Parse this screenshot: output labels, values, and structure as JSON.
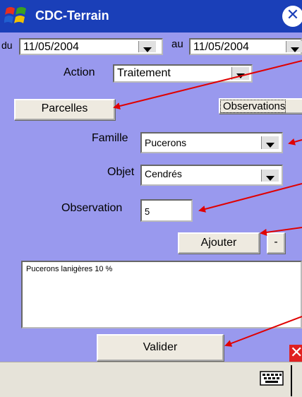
{
  "window": {
    "title": "CDC-Terrain"
  },
  "dates": {
    "from_label": "du",
    "from_value": "11/05/2004",
    "to_label": "au",
    "to_value": "11/05/2004"
  },
  "action": {
    "label": "Action",
    "value": "Traitement"
  },
  "buttons": {
    "parcelles": "Parcelles",
    "observations": "Observations",
    "ajouter": "Ajouter",
    "minus": "-",
    "valider": "Valider"
  },
  "famille": {
    "label": "Famille",
    "value": "Pucerons"
  },
  "objet": {
    "label": "Objet",
    "value": "Cendrés"
  },
  "observation": {
    "label": "Observation",
    "value": "5"
  },
  "list": {
    "text": "Pucerons lanigères 10 %"
  },
  "colors": {
    "titlebar": "#1a3fb8",
    "background": "#9999ee",
    "annotation_arrow": "#e00000",
    "bottombar": "#e6e3d9"
  }
}
